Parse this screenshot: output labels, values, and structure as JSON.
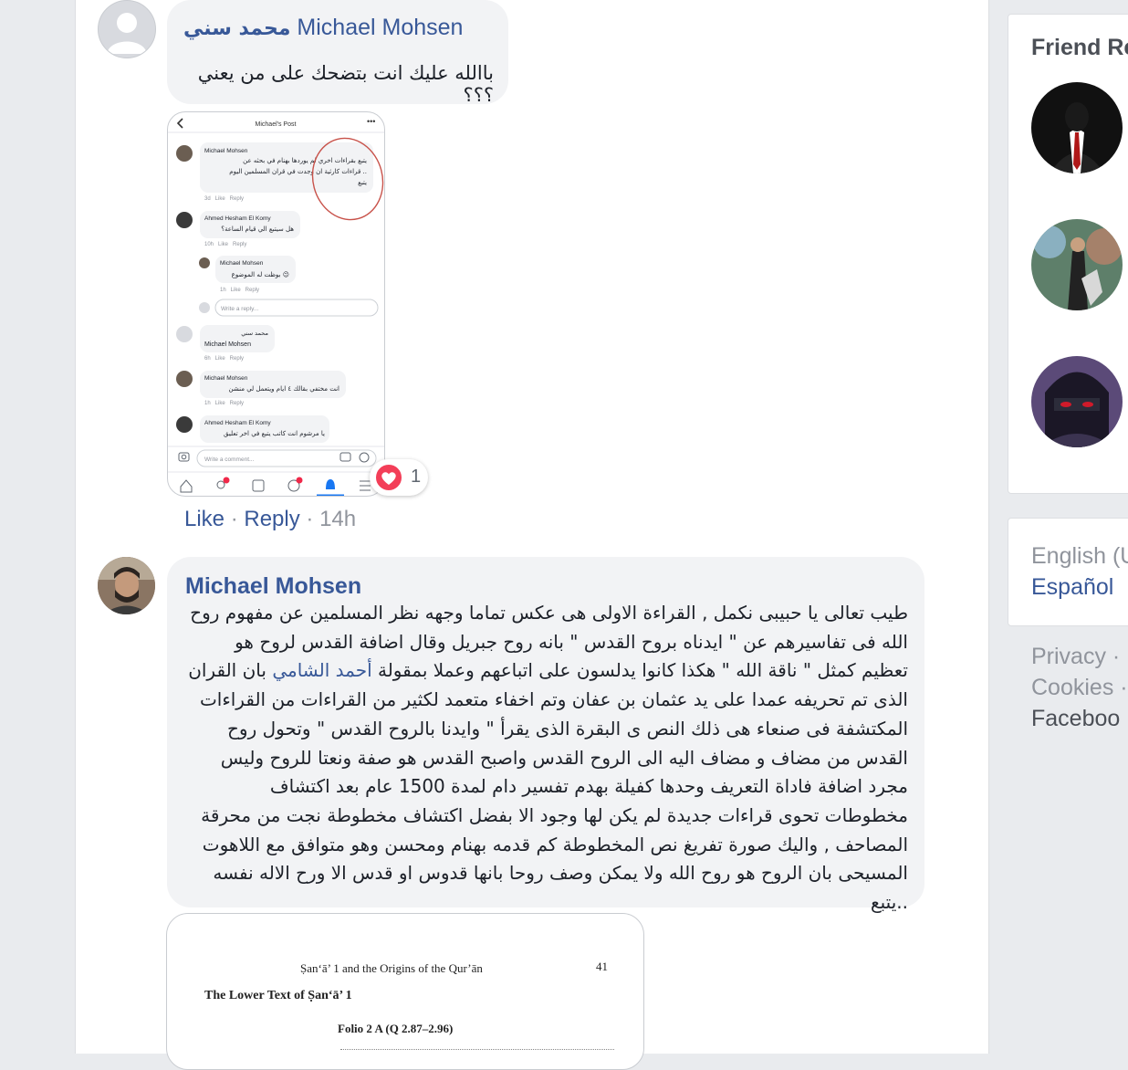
{
  "comment1": {
    "name_ar": "محمد سني",
    "name_en": "Michael Mohsen",
    "text": "باالله عليك انت بتضحك على من يعني ؟؟؟",
    "reaction_count": "1",
    "like_label": "Like",
    "reply_label": "Reply",
    "time": "14h"
  },
  "screenshot": {
    "header_title": "Michael's Post",
    "c1_name": "Michael Mohsen",
    "c1_text_1": "يتبع بقراءات اخري لم يوردها بهنام في بحثه عن",
    "c1_text_2": "قراءات كارثية ان وجدت في قران المسلمين اليوم ..",
    "c1_text_3": "يتبع",
    "c1_meta": "3d   Like   Reply",
    "c2_name": "Ahmed Hesham El Komy",
    "c2_text": "هل سيتبع الي قيام الساعة؟",
    "c2_meta": "10h   Like   Reply",
    "c3_name": "Michael Mohsen",
    "c3_text": "بوظت له الموضوع 😉",
    "c3_meta": "1h   Like   Reply",
    "reply_placeholder": "Write a reply...",
    "c4_name_ar": "محمد سني",
    "c4_name": "Michael Mohsen",
    "c4_meta": "6h   Like   Reply",
    "c5_name": "Michael Mohsen",
    "c5_text": "انت مختفي بقالك ٤ ايام ويتعمل لي منشن",
    "c5_meta": "1h   Like   Reply",
    "c6_name": "Ahmed Hesham El Komy",
    "c6_text": "يا مرشوم انت كاتب يتبع في اخر تعليق",
    "comment_placeholder": "Write a comment..."
  },
  "comment2": {
    "name": "Michael Mohsen",
    "text_before_mention": "طيب تعالى يا حبيبى نكمل , القراءة الاولى هى عكس تماما وجهه نظر المسلمين عن مفهوم روح الله فى تفاسيرهم عن \" ايدناه بروح القدس \" بانه روح جبريل وقال اضافة القدس لروح هو تعظيم كمثل \" ناقة الله \" هكذا كانوا يدلسون على اتباعهم وعملا بمقولة",
    "mention": "أحمد الشامي",
    "text_after_mention": "بان القران الذى تم تحريفه عمدا على يد عثمان بن عفان وتم اخفاء متعمد لكثير من القراءات من القراءات المكتشفة فى صنعاء هى ذلك النص ى البقرة الذى يقرأ \" وايدنا بالروح القدس \" وتحول روح القدس من مضاف و مضاف اليه الى الروح القدس واصبح القدس هو صفة ونعتا للروح وليس مجرد اضافة فاداة التعريف وحدها كفيلة بهدم تفسير دام لمدة 1500 عام بعد اكتشاف مخطوطات تحوى قراءات جديدة لم يكن لها وجود الا بفضل اكتشاف مخطوطة نجت من محرقة المصاحف , واليك صورة تفريغ نص المخطوطة كم قدمه بهنام ومحسن وهو متوافق مع اللاهوت المسيحى بان الروح هو روح الله ولا يمكن وصف روحا بانها قدوس او قدس الا ورح الاله نفسه ..يتبع"
  },
  "document": {
    "running_head": "Ṣan‘ā’ 1 and the Origins of the Qur’ān",
    "page_number": "41",
    "heading": "The Lower Text of Ṣan‘ā’ 1",
    "folio": "Folio 2 A (Q 2.87–2.96)"
  },
  "right_column": {
    "friend_title": "Friend Re",
    "lang_current": "English (U",
    "lang_alt": "Español",
    "footer_1": "Privacy ·",
    "footer_2": "Cookies ·",
    "footer_3": "Faceboo"
  },
  "colors": {
    "link": "#385898",
    "bubble": "#f2f3f5",
    "page_bg": "#e9ebee",
    "love": "#f33e58"
  }
}
